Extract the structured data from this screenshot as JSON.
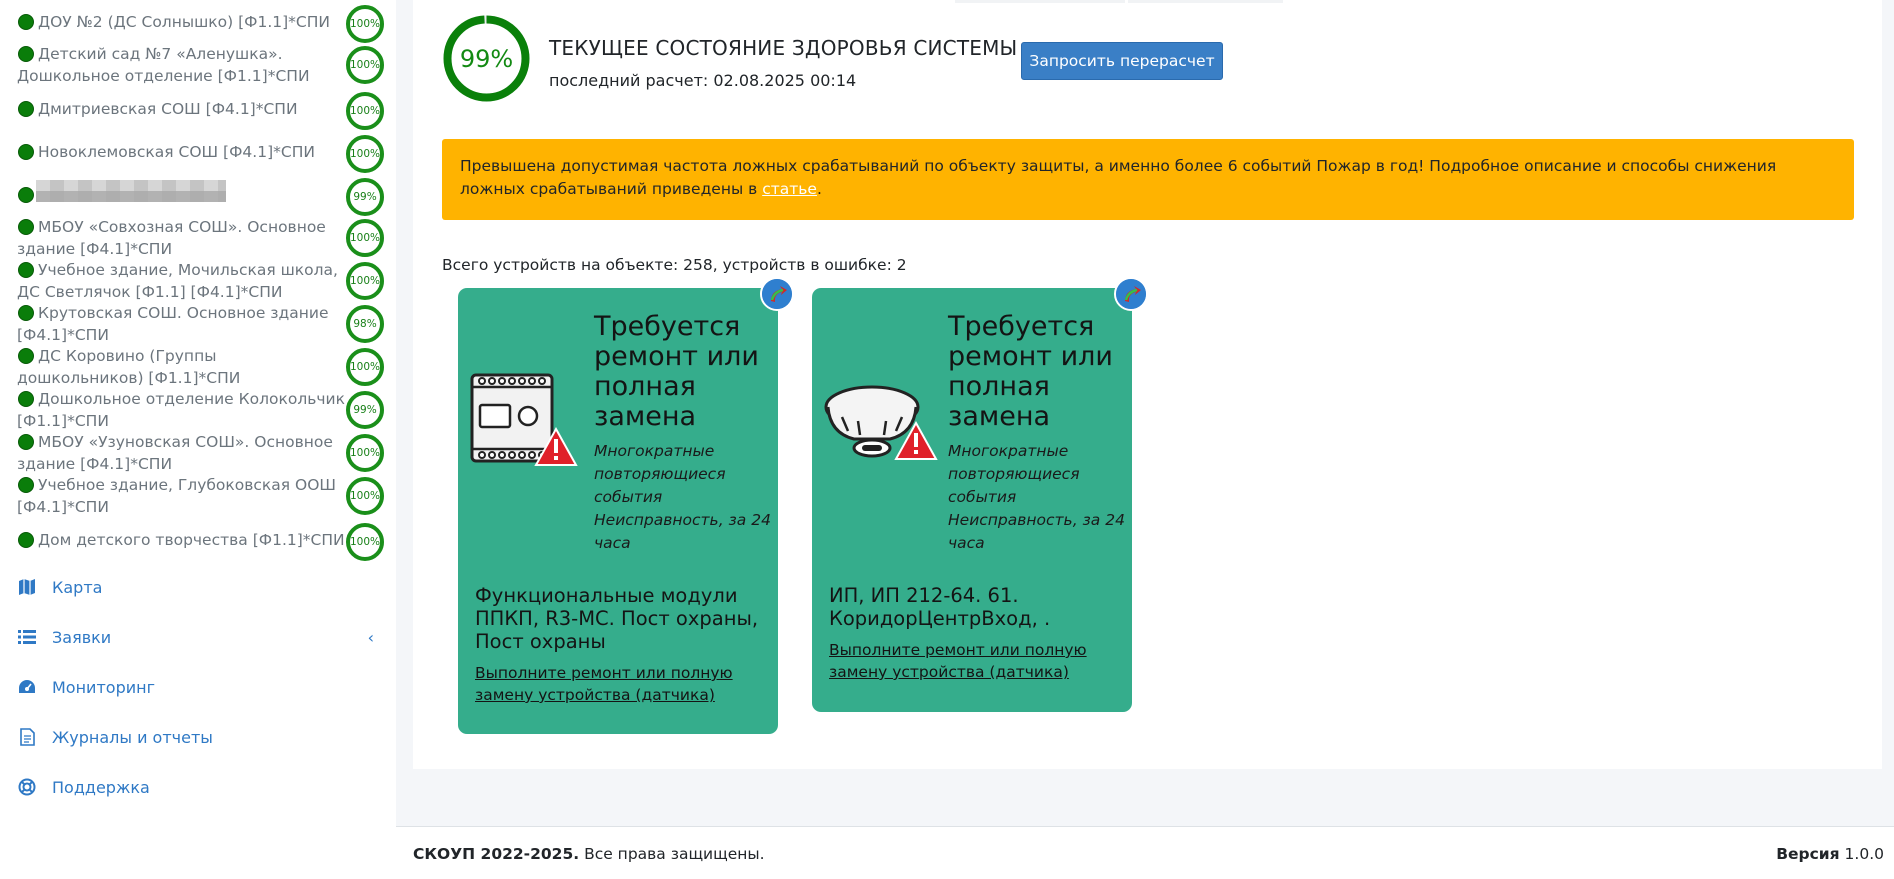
{
  "sidebar": {
    "sites": [
      {
        "name": "ДОУ №2 (ДС Солнышко) [Ф1.1]*СПИ",
        "pct": "100%"
      },
      {
        "name": "Детский сад №7 «Аленушка». Дошкольное отделение [Ф1.1]*СПИ",
        "pct": "100%"
      },
      {
        "name": "Дмитриевская СОШ [Ф4.1]*СПИ",
        "pct": "100%"
      },
      {
        "name": "Новоклемовская СОШ [Ф4.1]*СПИ",
        "pct": "100%"
      },
      {
        "name": "",
        "pct": "99%"
      },
      {
        "name": "МБОУ «Совхозная СОШ». Основное здание [Ф4.1]*СПИ",
        "pct": "100%"
      },
      {
        "name": "Учебное здание, Мочильская школа, ДС Светлячок [Ф1.1] [Ф4.1]*СПИ",
        "pct": "100%"
      },
      {
        "name": "Крутовская СОШ. Основное здание [Ф4.1]*СПИ",
        "pct": "98%"
      },
      {
        "name": "ДС Коровино (Группы дошкольников) [Ф1.1]*СПИ",
        "pct": "100%"
      },
      {
        "name": "Дошкольное отделение Колокольчик [Ф1.1]*СПИ",
        "pct": "99%"
      },
      {
        "name": "МБОУ «Узуновская СОШ». Основное здание [Ф4.1]*СПИ",
        "pct": "100%"
      },
      {
        "name": "Учебное здание, Глубоковская ООШ [Ф4.1]*СПИ",
        "pct": "100%"
      },
      {
        "name": "Дом детского творчества [Ф1.1]*СПИ",
        "pct": "100%"
      }
    ],
    "nav": [
      {
        "label": "Карта",
        "icon": "map-icon"
      },
      {
        "label": "Заявки",
        "icon": "list-icon",
        "caret": "‹"
      },
      {
        "label": "Мониторинг",
        "icon": "dashboard-icon"
      },
      {
        "label": "Журналы и отчеты",
        "icon": "document-icon"
      },
      {
        "label": "Поддержка",
        "icon": "lifebuoy-icon"
      }
    ]
  },
  "health": {
    "percent_label": "99%",
    "percent_value": 0.99,
    "title": "ТЕКУЩЕЕ СОСТОЯНИЕ ЗДОРОВЬЯ СИСТЕМЫ",
    "last_calc": "последний расчет: 02.08.2025 00:14",
    "recalc_button": "Запросить перерасчет"
  },
  "alert": {
    "text": "Превышена допустимая частота ложных срабатываний по объекту защиты, а именно более 6 событий Пожар в год! Подробное описание и способы снижения ложных срабатываний приведены в ",
    "link_text": "статье",
    "suffix": "."
  },
  "devices": {
    "summary": "Всего устройств на объекте: 258, устройств в ошибке: 2",
    "cards": [
      {
        "title": "Требуется ремонт или полная замена",
        "reason": "Многократные повторяющиеся события Неисправность, за 24 часа",
        "device": "Функциональные модули ППКП, R3-МС. Пост охраны, Пост охраны",
        "action": "Выполните ремонт или полную замену устройства (датчика)",
        "image": "control-module-icon"
      },
      {
        "title": "Требуется ремонт или полная замена",
        "reason": "Многократные повторяющиеся события Неисправность, за 24 часа",
        "device": "ИП, ИП 212-64. 61. КоридорЦентрВход, .",
        "action": "Выполните ремонт или полную замену устройства (датчика)",
        "image": "smoke-detector-icon"
      }
    ]
  },
  "footer": {
    "copyright_bold": "СКОУП 2022-2025.",
    "copyright_rest": " Все права защищены.",
    "version_bold": "Версия",
    "version_value": " 1.0.0"
  },
  "colors": {
    "ok_green": "#0a7d0a",
    "card_teal": "#35ad8c",
    "alert_amber": "#ffb300",
    "link_blue": "#2f79c5",
    "button_blue": "#3a7fc6"
  }
}
